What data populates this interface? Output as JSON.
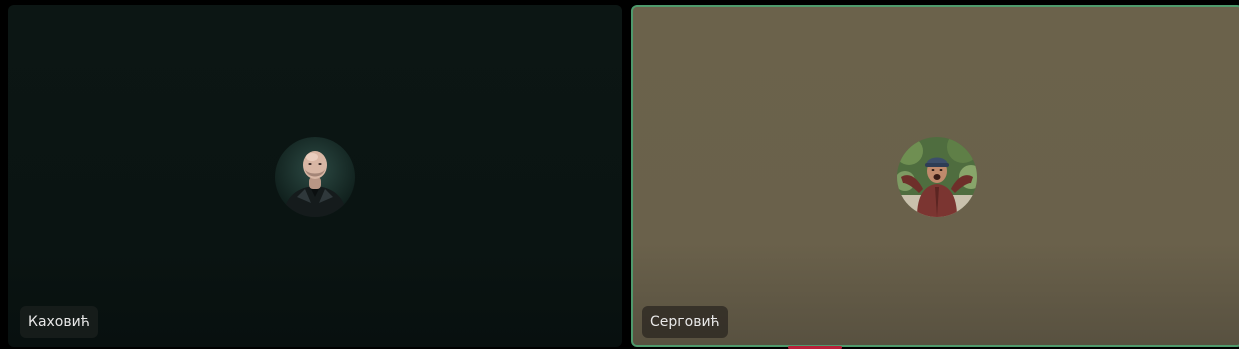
{
  "participants": [
    {
      "name": "Каховић",
      "avatar_icon": "bald-man-leather-jacket-avatar",
      "active_speaker": false,
      "tile_color": "#0b1513"
    },
    {
      "name": "Серговић",
      "avatar_icon": "man-in-cap-red-shirt-avatar",
      "active_speaker": true,
      "tile_color": "#6b624b",
      "speaker_border_color": "#4f9a6c"
    }
  ]
}
